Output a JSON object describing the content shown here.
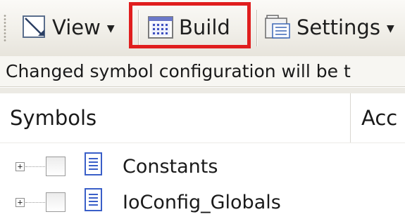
{
  "toolbar": {
    "view_label": "View",
    "build_label": "Build",
    "settings_label": "Settings",
    "dropdown_arrow": "▼",
    "highlight_color": "#e01e1e"
  },
  "info_bar": {
    "text": "Changed symbol configuration will be t"
  },
  "grid": {
    "columns": [
      "Symbols",
      "Acc"
    ]
  },
  "tree": {
    "expander_glyph": "+",
    "items": [
      {
        "label": "Constants",
        "icon": "document-icon",
        "checked": false
      },
      {
        "label": "IoConfig_Globals",
        "icon": "document-icon",
        "checked": false
      }
    ]
  }
}
